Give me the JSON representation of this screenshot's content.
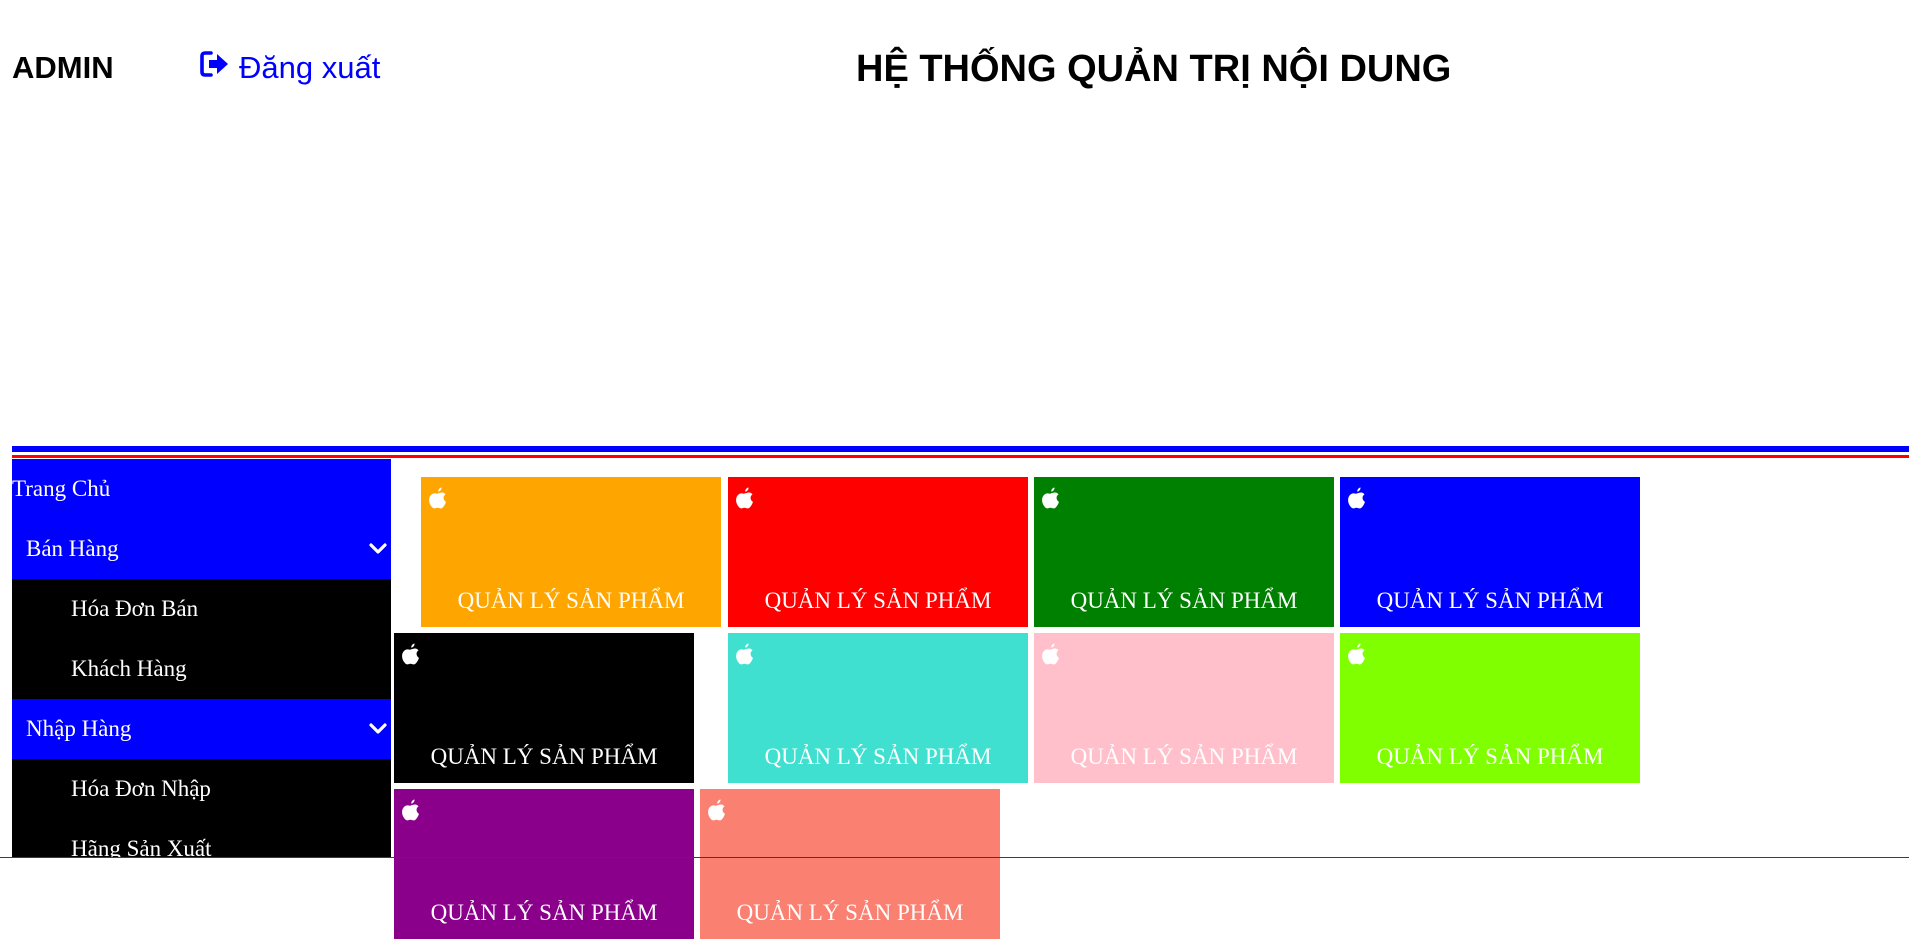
{
  "header": {
    "admin_label": "ADMIN",
    "logout_label": "Đăng xuất",
    "logout_icon": "sign-out-icon",
    "title": "HỆ THỐNG QUẢN TRỊ NỘI DUNG"
  },
  "colors": {
    "link": "#0000ff",
    "rule_top": "#0000ff",
    "rule_bottom": "#ff0000",
    "sidebar_group": "#0000ff",
    "sidebar_sub": "#000000"
  },
  "sidebar": {
    "items": [
      {
        "label": "Trang Chủ",
        "kind": "top"
      },
      {
        "label": "Bán Hàng",
        "kind": "group",
        "icon": "chevron-down-icon"
      },
      {
        "label": "Hóa Đơn Bán",
        "kind": "sub"
      },
      {
        "label": "Khách Hàng",
        "kind": "sub"
      },
      {
        "label": "Nhập Hàng",
        "kind": "group",
        "icon": "chevron-down-icon"
      },
      {
        "label": "Hóa Đơn Nhập",
        "kind": "sub"
      },
      {
        "label": "Hãng Sản Xuất",
        "kind": "sub"
      }
    ]
  },
  "tiles": [
    {
      "label": "QUẢN LÝ SẢN PHẨM",
      "color": "#ffa500",
      "icon": "apple-icon"
    },
    {
      "label": "QUẢN LÝ SẢN PHẨM",
      "color": "#ff0000",
      "icon": "apple-icon"
    },
    {
      "label": "QUẢN LÝ SẢN PHẨM",
      "color": "#008000",
      "icon": "apple-icon"
    },
    {
      "label": "QUẢN LÝ SẢN PHẨM",
      "color": "#0000ff",
      "icon": "apple-icon"
    },
    {
      "label": "QUẢN LÝ SẢN PHẨM",
      "color": "#000000",
      "icon": "apple-icon"
    },
    {
      "label": "QUẢN LÝ SẢN PHẨM",
      "color": "#40e0d0",
      "icon": "apple-icon"
    },
    {
      "label": "QUẢN LÝ SẢN PHẨM",
      "color": "#ffc0cb",
      "icon": "apple-icon"
    },
    {
      "label": "QUẢN LÝ SẢN PHẨM",
      "color": "#7fff00",
      "icon": "apple-icon"
    },
    {
      "label": "QUẢN LÝ SẢN PHẨM",
      "color": "#8b008b",
      "icon": "apple-icon"
    },
    {
      "label": "QUẢN LÝ SẢN PHẨM",
      "color": "#fa8072",
      "icon": "apple-icon"
    }
  ]
}
